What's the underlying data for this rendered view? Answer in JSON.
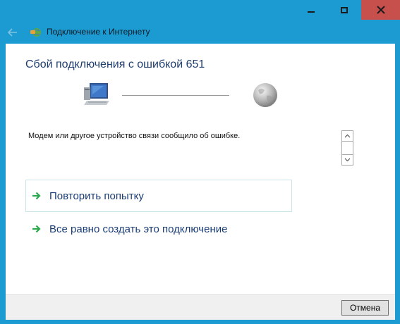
{
  "window": {
    "title": "Подключение к Интернету",
    "controls": [
      "minimize",
      "maximize",
      "close"
    ]
  },
  "main": {
    "heading": "Сбой подключения с ошибкой 651",
    "message": "Модем или другое устройство связи сообщило об ошибке.",
    "retry_label": "Повторить попытку",
    "create_anyway_label": "Все равно создать это подключение"
  },
  "footer": {
    "cancel_label": "Отмена"
  },
  "icons": {
    "back": "back-arrow-icon",
    "network": "network-connection-icon",
    "computer": "computer-icon",
    "globe": "globe-icon",
    "command_arrow": "green-arrow-icon"
  },
  "colors": {
    "title_bar": "#1b9bd1",
    "close_button": "#c7504d",
    "heading_text": "#1e3c6e",
    "link_text": "#1a3c75",
    "link_arrow": "#2ea84f"
  }
}
